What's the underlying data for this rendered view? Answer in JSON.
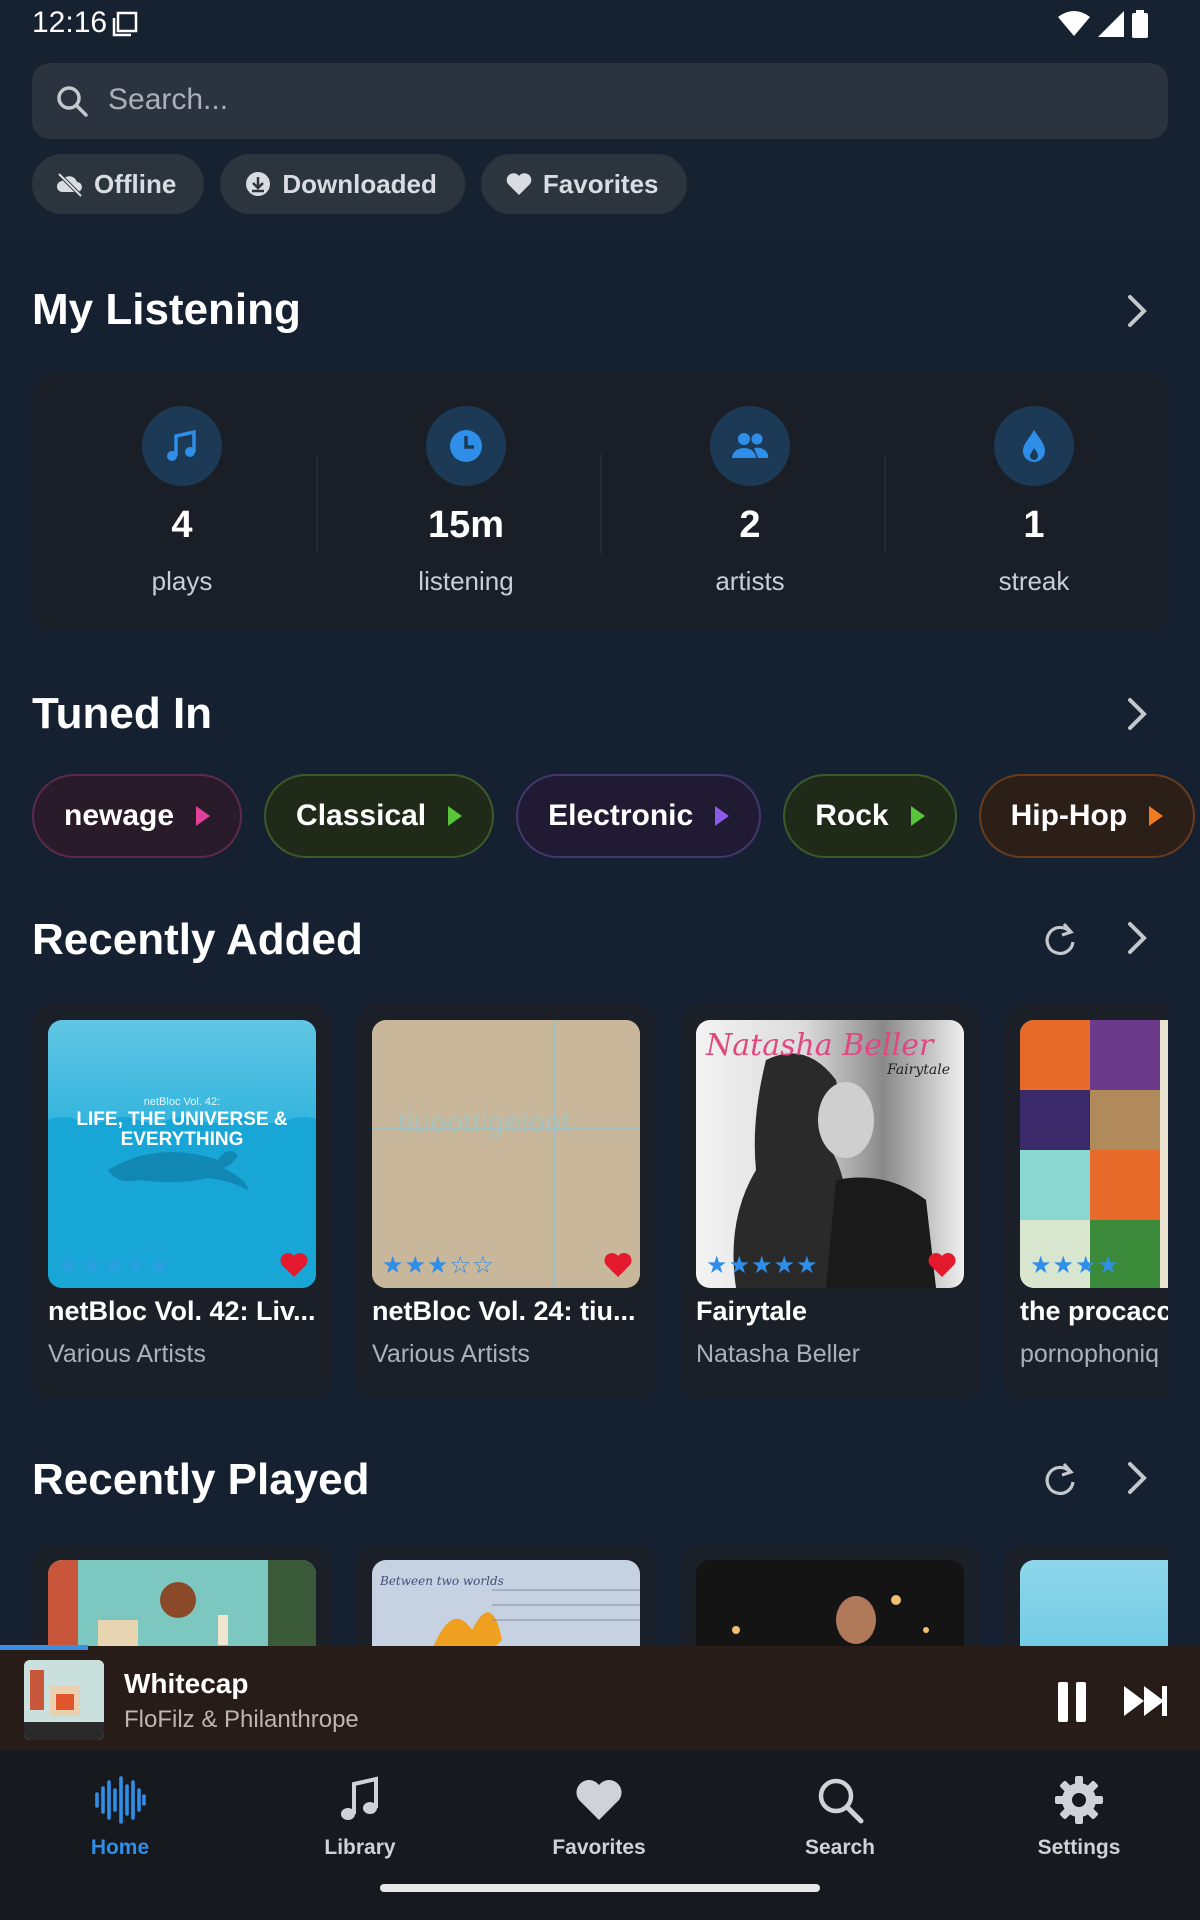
{
  "status": {
    "time": "12:16"
  },
  "search": {
    "placeholder": "Search..."
  },
  "filters": [
    {
      "label": "Offline",
      "icon": "cloud-off-icon"
    },
    {
      "label": "Downloaded",
      "icon": "download-icon"
    },
    {
      "label": "Favorites",
      "icon": "heart-icon"
    }
  ],
  "my_listening": {
    "title": "My Listening",
    "stats": [
      {
        "value": "4",
        "label": "plays",
        "icon": "music-note-icon"
      },
      {
        "value": "15m",
        "label": "listening",
        "icon": "clock-icon"
      },
      {
        "value": "2",
        "label": "artists",
        "icon": "people-icon"
      },
      {
        "value": "1",
        "label": "streak",
        "icon": "flame-icon"
      }
    ]
  },
  "tuned_in": {
    "title": "Tuned In",
    "genres": [
      {
        "label": "newage",
        "color": "#e0409a"
      },
      {
        "label": "Classical",
        "color": "#5ac43b"
      },
      {
        "label": "Electronic",
        "color": "#8a5ae8"
      },
      {
        "label": "Rock",
        "color": "#5ac43b"
      },
      {
        "label": "Hip-Hop",
        "color": "#f07a22"
      }
    ]
  },
  "recently_added": {
    "title": "Recently Added",
    "albums": [
      {
        "title": "netBloc Vol. 42: Liv...",
        "artist": "Various Artists",
        "rating": 0,
        "stars": "★★★★★",
        "favorite": true,
        "cover_text": "LIFE, THE UNIVERSE & EVERYTHING",
        "cover_small": "netBloc Vol. 42:"
      },
      {
        "title": "netBloc Vol. 24: tiu...",
        "artist": "Various Artists",
        "rating": 3,
        "stars": "★★★☆☆",
        "favorite": true,
        "cover_text": "tiuoottigeloot"
      },
      {
        "title": "Fairytale",
        "artist": "Natasha Beller",
        "rating": 5,
        "stars": "★★★★★",
        "favorite": true,
        "cover_text": "Natasha Beller",
        "cover_small": "Fairytale"
      },
      {
        "title": "the procacc",
        "artist": "pornophoniq",
        "rating": 4,
        "stars": "★★★★",
        "favorite": false
      }
    ]
  },
  "recently_played": {
    "title": "Recently Played",
    "cover_text_2": "Between two worlds"
  },
  "now_playing": {
    "title": "Whitecap",
    "artist": "FloFilz & Philanthrope",
    "progress": 0.073
  },
  "nav": [
    {
      "label": "Home",
      "icon": "waveform-icon",
      "active": true
    },
    {
      "label": "Library",
      "icon": "music-note-icon"
    },
    {
      "label": "Favorites",
      "icon": "heart-icon"
    },
    {
      "label": "Search",
      "icon": "search-icon"
    },
    {
      "label": "Settings",
      "icon": "gear-icon"
    }
  ]
}
